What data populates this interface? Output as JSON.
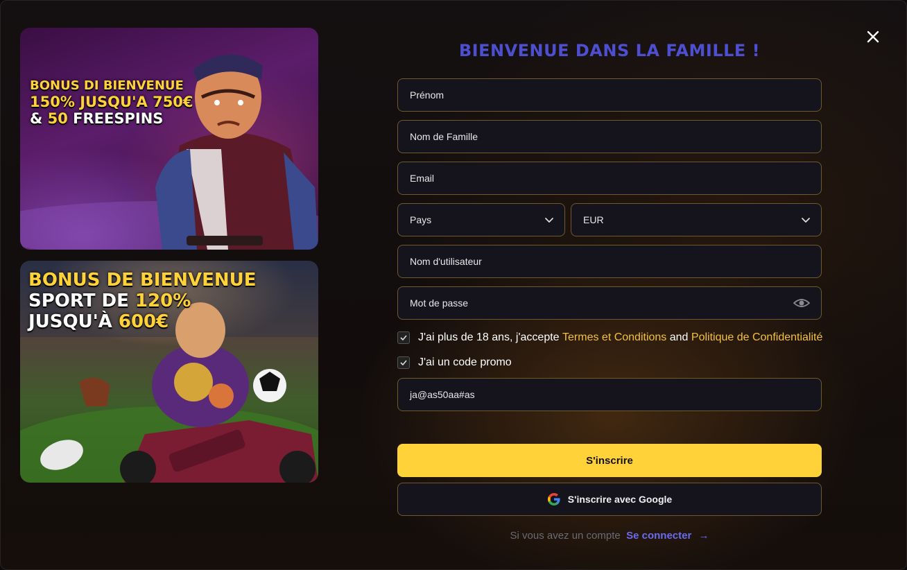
{
  "banners": {
    "casino": {
      "line1": "BONUS DI BIENVENUE",
      "line2_prefix": "150% JUSQU'A ",
      "line2_amount": "750€",
      "line3_prefix": "& ",
      "line3_amount": "50",
      "line3_suffix": " FREESPINS"
    },
    "sport": {
      "line1": "BONUS DE BIENVENUE",
      "line2_prefix": "SPORT DE ",
      "line2_amount": "120%",
      "line3_prefix": "JUSQU'À ",
      "line3_amount": "600€"
    }
  },
  "title": "BIENVENUE DANS LA FAMILLE !",
  "form": {
    "first_name": "Prénom",
    "last_name": "Nom de Famille",
    "email": "Email",
    "country": "Pays",
    "currency": "EUR",
    "username": "Nom d'utilisateur",
    "password": "Mot de passe",
    "promo_code": "ja@as50aa#as"
  },
  "terms": {
    "prefix": "J'ai plus de 18 ans, j'accepte ",
    "terms_link": "Termes et Conditions",
    "and": " and ",
    "privacy_link": "Politique de Confidentialité",
    "checked": true
  },
  "promo_check": {
    "label": "J'ai un code promo",
    "checked": true
  },
  "buttons": {
    "signup": "S'inscrire",
    "google": "S'inscrire avec Google"
  },
  "login": {
    "prompt": "Si vous avez un compte ",
    "link": "Se connecter",
    "arrow": "→"
  },
  "colors": {
    "accent_yellow": "#ffd23a",
    "title_blue": "#4d4fd0",
    "link_blue": "#6a6cf0",
    "field_border": "#6f5a2b"
  }
}
